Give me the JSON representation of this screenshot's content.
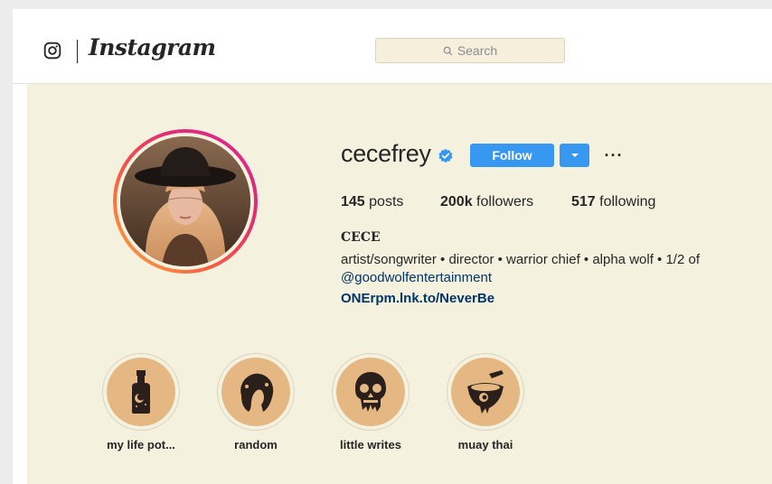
{
  "header": {
    "logo_icon": "instagram-glyph-icon",
    "wordmark": "Instagram",
    "search": {
      "placeholder": "Search",
      "icon": "search-icon"
    }
  },
  "profile": {
    "username": "cecefrey",
    "verified_icon": "verified-badge-icon",
    "follow_label": "Follow",
    "dropdown_icon": "caret-down-icon",
    "more_label": "···",
    "stats": {
      "posts_count": "145",
      "posts_label": "posts",
      "followers_count": "200k",
      "followers_label": "followers",
      "following_count": "517",
      "following_label": "following"
    },
    "full_name": "CECE",
    "bio": "artist/songwriter • director • warrior chief • alpha wolf • 1/2 of",
    "bio_mention": "@goodwolfentertainment",
    "bio_link": "ONErpm.lnk.to/NeverBe"
  },
  "highlights": [
    {
      "label": "my life pot...",
      "icon": "potion-bottle-icon"
    },
    {
      "label": "random",
      "icon": "hair-face-icon"
    },
    {
      "label": "little writes",
      "icon": "skull-icon"
    },
    {
      "label": "muay thai",
      "icon": "bowl-icon"
    }
  ],
  "colors": {
    "page_bg": "#f5f1df",
    "accent_blue": "#3897f0",
    "link_blue": "#003569",
    "highlight_fill": "#e5b883"
  }
}
